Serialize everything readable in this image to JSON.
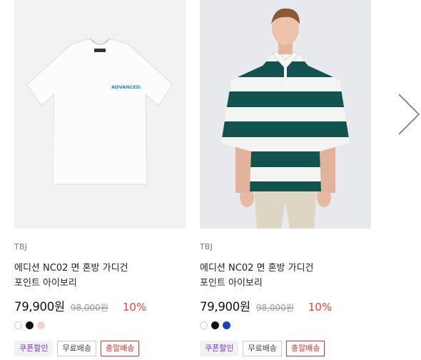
{
  "products": [
    {
      "brand": "TBJ",
      "name_line1": "에디션 NC02 면 혼방 가디건",
      "name_line2": "포인트 아이보리",
      "price": "79,900원",
      "original_price": "98,000원",
      "discount": "10%",
      "swatches": [
        "#ffffff",
        "#111111",
        "#f1d3c6"
      ],
      "image_text": "ADVANCED.",
      "badges": {
        "coupon": "쿠폰할인",
        "free_shipping": "무료배송",
        "gun": "총알배송"
      }
    },
    {
      "brand": "TBJ",
      "name_line1": "에디션 NC02 면 혼방 가디건",
      "name_line2": "포인트 아이보리",
      "price": "79,900원",
      "original_price": "98,000원",
      "discount": "10%",
      "swatches": [
        "#ffffff",
        "#111111",
        "#1b3fbf"
      ],
      "badges": {
        "coupon": "쿠폰할인",
        "free_shipping": "무료배송",
        "gun": "총알배송"
      }
    }
  ],
  "colors": {
    "discount": "#f0403c",
    "coupon": "#7a2fd6",
    "gun_delivery": "#e6332a",
    "stripe_green": "#13534f"
  },
  "icons": {
    "next": "chevron-right-icon"
  }
}
